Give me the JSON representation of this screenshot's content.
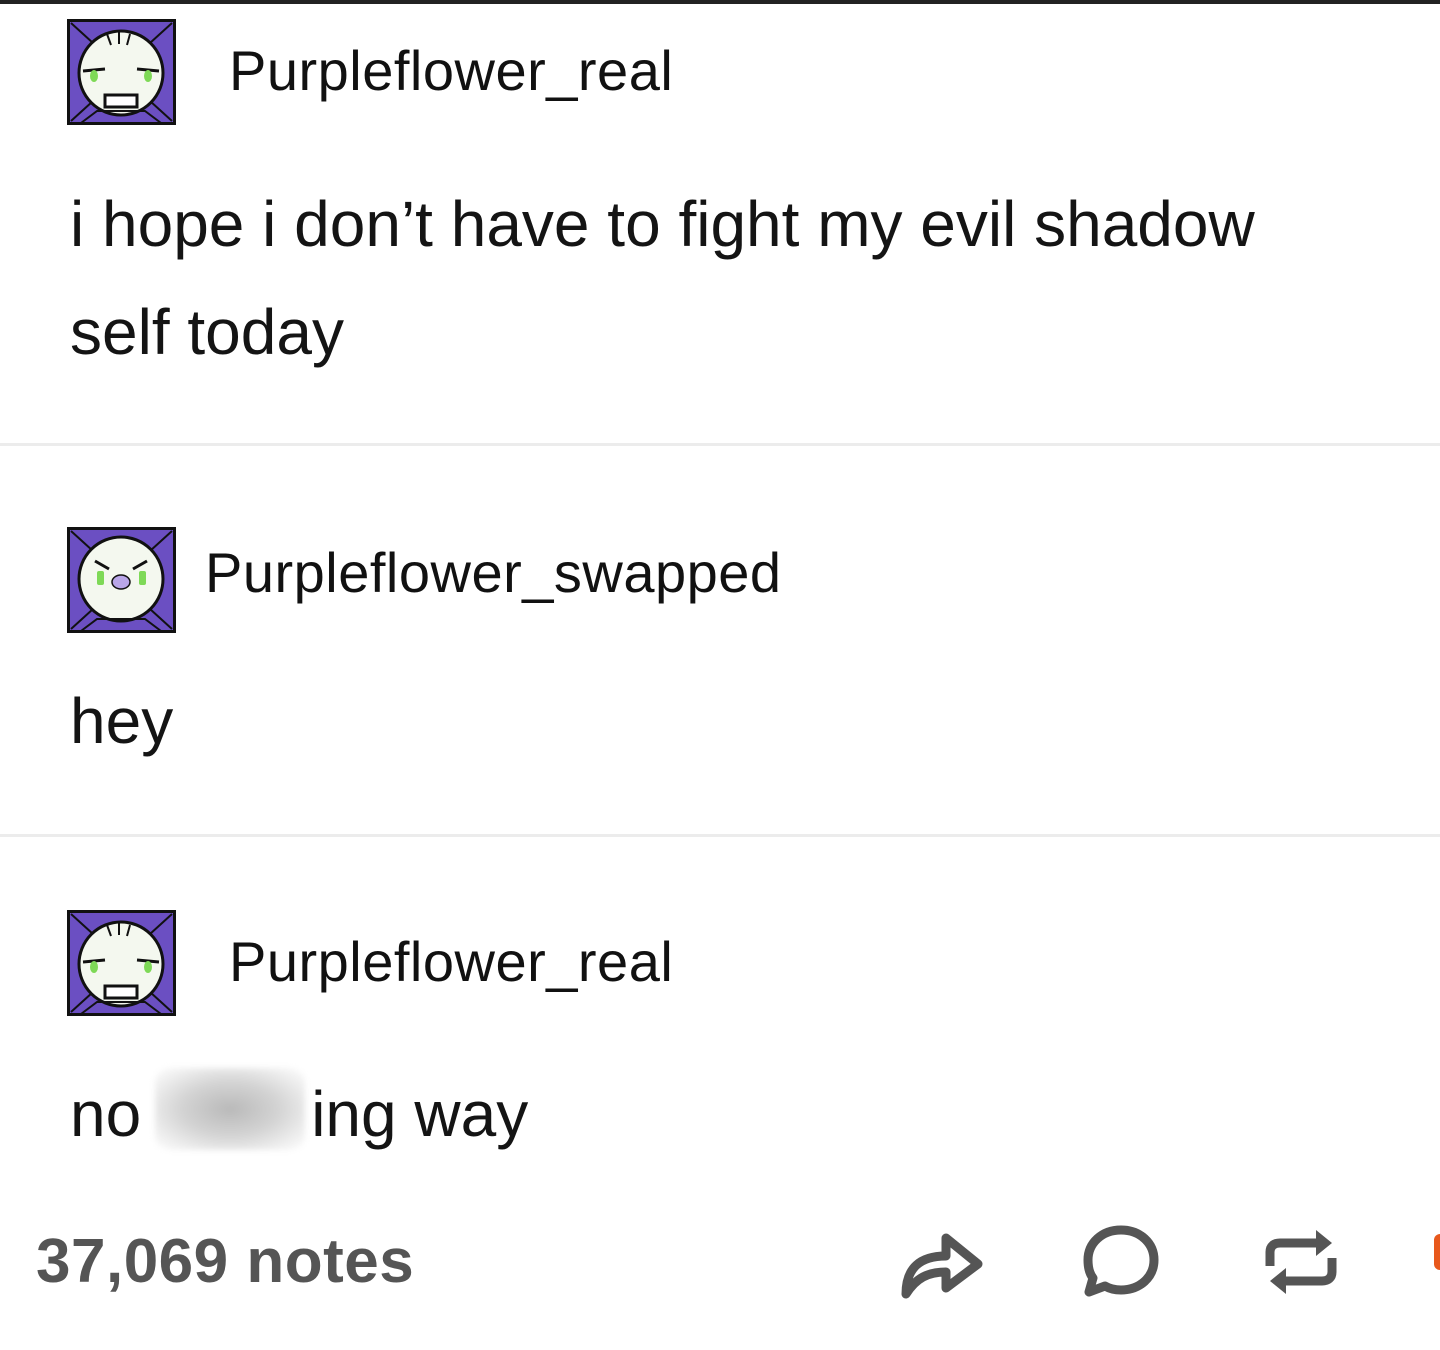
{
  "thread": [
    {
      "username": "Purpleflower_real",
      "avatar_icon": "purpleflower-real-avatar-icon",
      "lines": [
        "i hope i don’t have to fight my evil shadow",
        "self today"
      ]
    },
    {
      "username": "Purpleflower_swapped",
      "avatar_icon": "purpleflower-swapped-avatar-icon",
      "lines": [
        "hey"
      ]
    },
    {
      "username": "Purpleflower_real",
      "avatar_icon": "purpleflower-real-avatar-icon",
      "text_before": "no",
      "text_after": "ing way"
    }
  ],
  "footer": {
    "notes": "37,069 notes",
    "share_icon": "share-arrow-icon",
    "reply_icon": "comment-bubble-icon",
    "reblog_icon": "reblog-icon"
  },
  "colors": {
    "avatar_purple": "#6b4fc2",
    "eye_green": "#7ed957",
    "notes_gray": "#555555",
    "divider": "#ececec"
  }
}
